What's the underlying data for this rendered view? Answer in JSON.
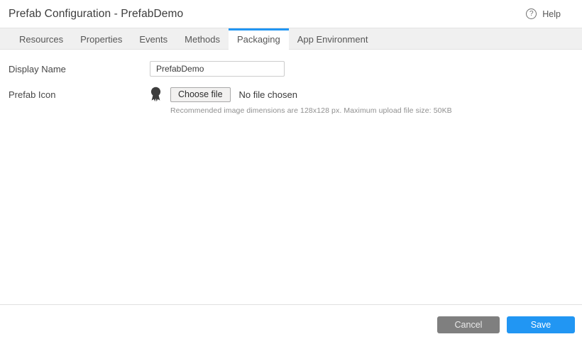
{
  "header": {
    "title": "Prefab Configuration - PrefabDemo",
    "help_label": "Help",
    "help_icon_glyph": "?"
  },
  "tabs": {
    "items": [
      {
        "label": "Resources",
        "active": false
      },
      {
        "label": "Properties",
        "active": false
      },
      {
        "label": "Events",
        "active": false
      },
      {
        "label": "Methods",
        "active": false
      },
      {
        "label": "Packaging",
        "active": true
      },
      {
        "label": "App Environment",
        "active": false
      }
    ]
  },
  "form": {
    "display_name": {
      "label": "Display Name",
      "value": "PrefabDemo"
    },
    "prefab_icon": {
      "label": "Prefab Icon",
      "icon": "award-ribbon-icon",
      "choose_file_label": "Choose file",
      "file_status": "No file chosen",
      "hint": "Recommended image dimensions are 128x128 px. Maximum upload file size: 50KB"
    }
  },
  "footer": {
    "cancel_label": "Cancel",
    "save_label": "Save"
  },
  "colors": {
    "accent": "#2196f3",
    "save_bg": "#2196f3",
    "cancel_bg": "#7f7f7f",
    "tabbar_bg": "#f0f0f0"
  }
}
